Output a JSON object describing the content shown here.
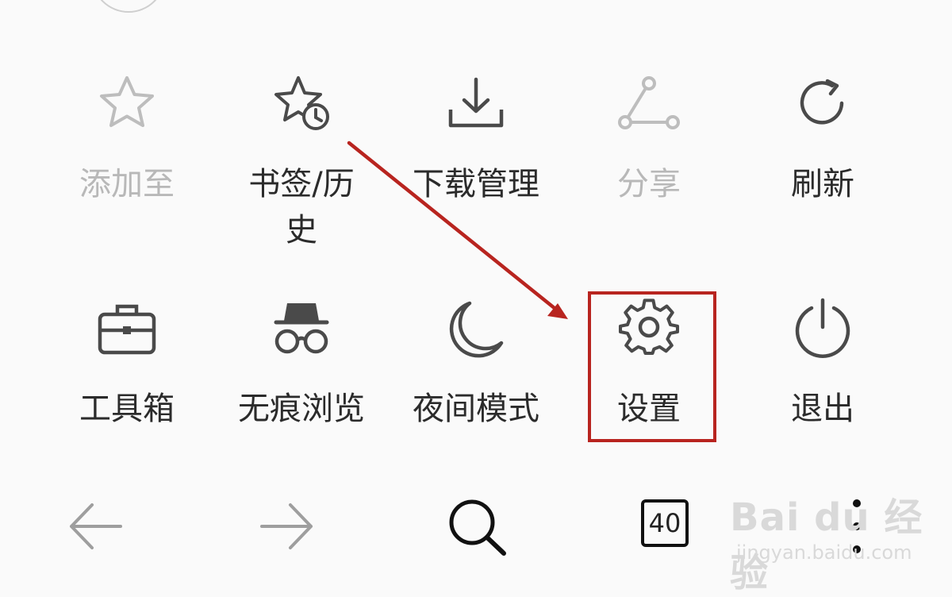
{
  "menu": {
    "row1": [
      {
        "label": "添加至",
        "icon": "star-outline-icon",
        "enabled": false
      },
      {
        "label": "书签/历史",
        "icon": "star-clock-icon",
        "enabled": true
      },
      {
        "label": "下载管理",
        "icon": "download-icon",
        "enabled": true
      },
      {
        "label": "分享",
        "icon": "share-icon",
        "enabled": false
      },
      {
        "label": "刷新",
        "icon": "refresh-icon",
        "enabled": true
      }
    ],
    "row2": [
      {
        "label": "工具箱",
        "icon": "toolbox-icon",
        "enabled": true
      },
      {
        "label": "无痕浏览",
        "icon": "incognito-icon",
        "enabled": true
      },
      {
        "label": "夜间模式",
        "icon": "moon-icon",
        "enabled": true
      },
      {
        "label": "设置",
        "icon": "gear-icon",
        "enabled": true
      },
      {
        "label": "退出",
        "icon": "power-icon",
        "enabled": true
      }
    ]
  },
  "bottom_bar": {
    "back": {
      "icon": "arrow-left-icon"
    },
    "forward": {
      "icon": "arrow-right-icon"
    },
    "search": {
      "icon": "search-icon"
    },
    "tabs_count": "40",
    "more": {
      "icon": "more-vertical-icon"
    }
  },
  "annotation": {
    "highlight_color": "#b8241f",
    "highlight_target": "设置"
  },
  "watermark": {
    "logo_text": "Bai du 经验",
    "sub_text": "jingyan.baidu.com"
  },
  "colors": {
    "icon_active": "#4a4a4a",
    "icon_disabled": "#bdbdbd",
    "label_active": "#2b2b2b",
    "label_disabled": "#b8b8b8",
    "background": "#fafafa"
  }
}
